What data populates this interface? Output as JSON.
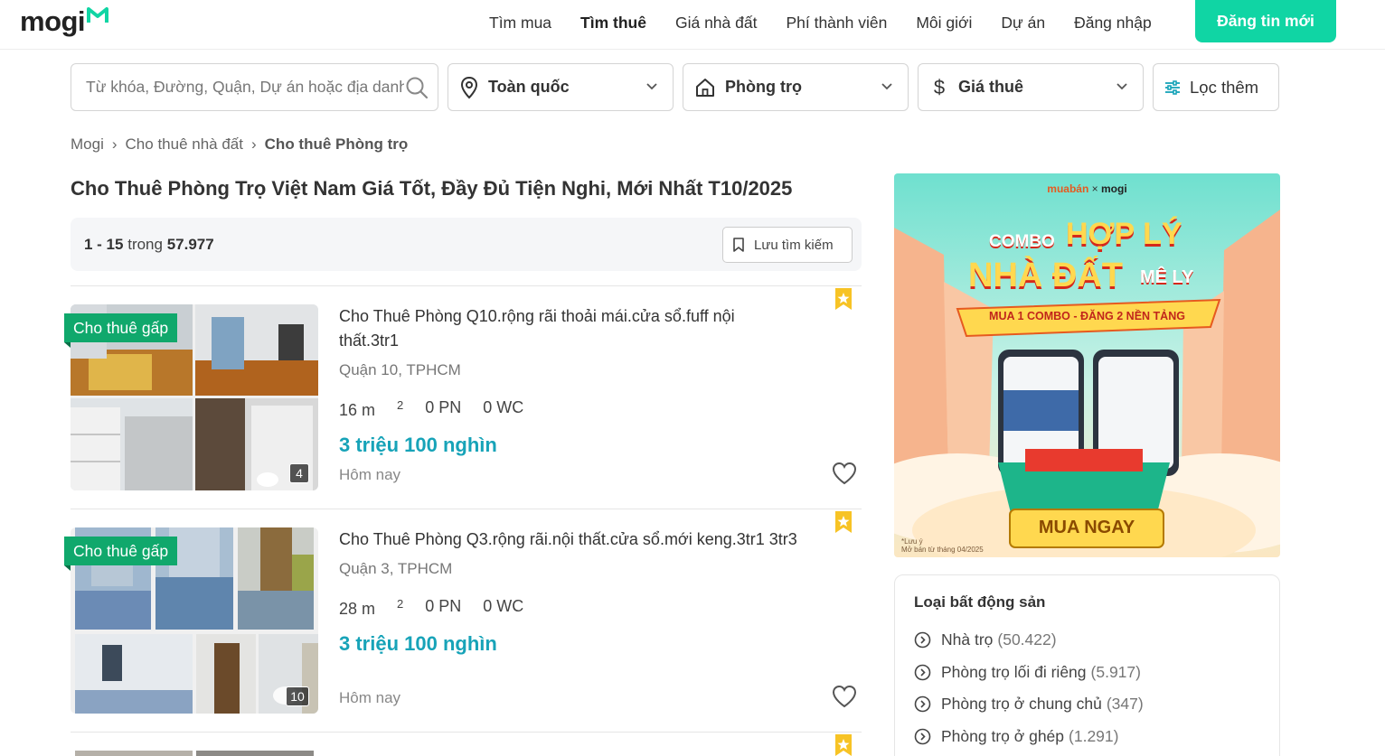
{
  "header": {
    "logo_text": "mogi",
    "nav": [
      "Tìm mua",
      "Tìm thuê",
      "Giá nhà đất",
      "Phí thành viên",
      "Môi giới",
      "Dự án",
      "Đăng nhập"
    ],
    "post_button": "Đăng tin mới",
    "accent_color": "#10d5a4"
  },
  "search": {
    "placeholder": "Từ khóa, Đường, Quận, Dự án hoặc địa danh ...",
    "location": "Toàn quốc",
    "property_type": "Phòng trọ",
    "price": "Giá thuê",
    "more_filters": "Lọc thêm"
  },
  "breadcrumb": [
    "Mogi",
    "Cho thuê nhà đất",
    "Cho thuê Phòng trọ"
  ],
  "page_title": "Cho Thuê Phòng Trọ Việt Nam Giá Tốt, Đầy Đủ Tiện Nghi, Mới Nhất T10/2025",
  "results": {
    "range": "1 - 15",
    "of_word": "trong",
    "total": "57.977",
    "save_search": "Lưu tìm kiếm"
  },
  "listings": [
    {
      "badge": "Cho thuê gấp",
      "title": "Cho Thuê Phòng Q10.rộng rãi thoải mái.cửa sổ.fuff nội thất.3tr1",
      "location": "Quận 10, TPHCM",
      "area": "16 m",
      "area_sup": "2",
      "bedrooms": "0 PN",
      "bathrooms": "0 WC",
      "price": "3 triệu 100 nghìn",
      "date": "Hôm nay",
      "photo_count": "4"
    },
    {
      "badge": "Cho thuê gấp",
      "title": "Cho Thuê Phòng Q3.rộng rãi.nội thất.cửa sổ.mới keng.3tr1 3tr3",
      "location": "Quận 3, TPHCM",
      "area": "28 m",
      "area_sup": "2",
      "bedrooms": "0 PN",
      "bathrooms": "0 WC",
      "price": "3 triệu 100 nghìn",
      "date": "Hôm nay",
      "photo_count": "10"
    }
  ],
  "ad": {
    "brand_left": "muabán",
    "brand_x": "×",
    "brand_right": "mogi",
    "line_combo": "COMBO",
    "line_hop_ly": "HỢP LÝ",
    "line_nha_dat": "NHÀ ĐẤT",
    "line_me_ly": "MÊ LY",
    "ribbon": "MUA 1 COMBO - ĐĂNG 2 NỀN TẢNG",
    "cta": "MUA NGAY",
    "note_1": "*Lưu ý",
    "note_2": "Mở bán từ tháng 04/2025"
  },
  "property_types": {
    "title": "Loại bất động sản",
    "items": [
      {
        "label": "Nhà trọ",
        "count": "(50.422)"
      },
      {
        "label": "Phòng trọ lối đi riêng",
        "count": "(5.917)"
      },
      {
        "label": "Phòng trọ ở chung chủ",
        "count": "(347)"
      },
      {
        "label": "Phòng trọ ở ghép",
        "count": "(1.291)"
      }
    ]
  }
}
